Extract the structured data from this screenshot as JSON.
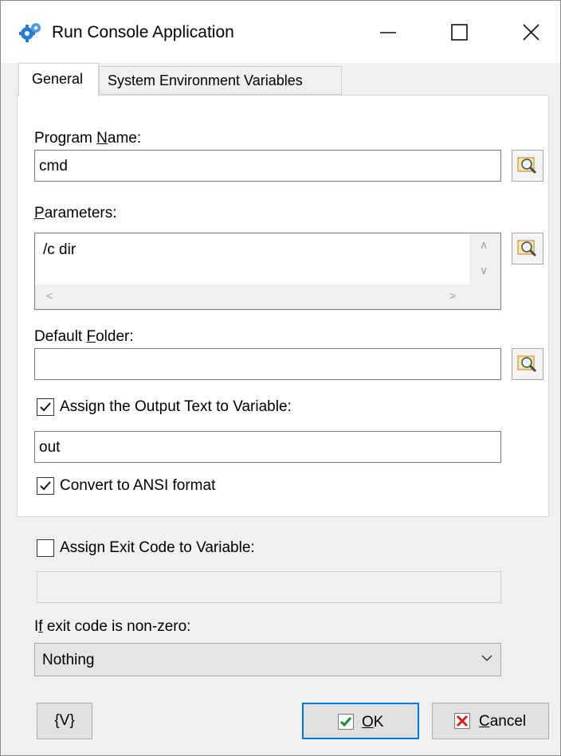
{
  "window": {
    "title": "Run Console Application",
    "minimize_label": "—",
    "maximize_label": "☐",
    "close_label": "✕"
  },
  "tabs": [
    {
      "label": "General",
      "selected": true
    },
    {
      "label": "System Environment Variables",
      "selected": false
    }
  ],
  "general": {
    "program_name": {
      "label_before": "Program ",
      "label_key": "N",
      "label_after": "ame:",
      "value": "cmd"
    },
    "parameters": {
      "label_key": "P",
      "label_after": "arameters:",
      "value": "/c dir"
    },
    "default_folder": {
      "label_before": "Default ",
      "label_key": "F",
      "label_after": "older:",
      "value": ""
    },
    "assign_output": {
      "label": "Assign the Output Text to Variable:",
      "checked": true,
      "value": "out"
    },
    "convert_ansi": {
      "label": "Convert to ANSI format",
      "checked": true
    }
  },
  "exit": {
    "assign_exit_code": {
      "label": "Assign Exit Code to Variable:",
      "checked": false,
      "value": ""
    },
    "non_zero": {
      "label_before": "I",
      "label_key": "f",
      "label_after": " exit code is non-zero:",
      "selected": "Nothing"
    }
  },
  "buttons": {
    "variables": "{V}",
    "ok_key": "O",
    "ok_rest": "K",
    "cancel_key": "C",
    "cancel_rest": "ancel"
  },
  "colors": {
    "accent": "#0078d7",
    "ok_check": "#1f8a2e",
    "cancel_x": "#d11f1f"
  }
}
